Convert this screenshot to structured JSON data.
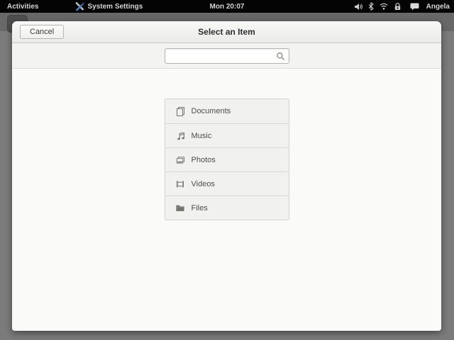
{
  "topbar": {
    "activities_label": "Activities",
    "app_name": "System Settings",
    "clock": "Mon 20:07",
    "user_name": "Angela",
    "status_icons": [
      "volume-icon",
      "bluetooth-icon",
      "wifi-icon",
      "rotation-lock-icon",
      "chat-icon"
    ]
  },
  "dialog": {
    "cancel_label": "Cancel",
    "title": "Select an Item",
    "search": {
      "value": "",
      "placeholder": ""
    },
    "items": [
      {
        "label": "Documents",
        "icon": "documents-icon"
      },
      {
        "label": "Music",
        "icon": "music-icon"
      },
      {
        "label": "Photos",
        "icon": "photos-icon"
      },
      {
        "label": "Videos",
        "icon": "videos-icon"
      },
      {
        "label": "Files",
        "icon": "files-icon"
      }
    ]
  },
  "colors": {
    "topbar_bg": "#040404",
    "backdrop": "#7b7b7b",
    "backdrop_band": "#686868",
    "dialog_bg": "#fafaf9",
    "list_row_bg": "#f1f1ef",
    "frame_border": "#d3d3d0",
    "title_text": "#2c2f31"
  }
}
